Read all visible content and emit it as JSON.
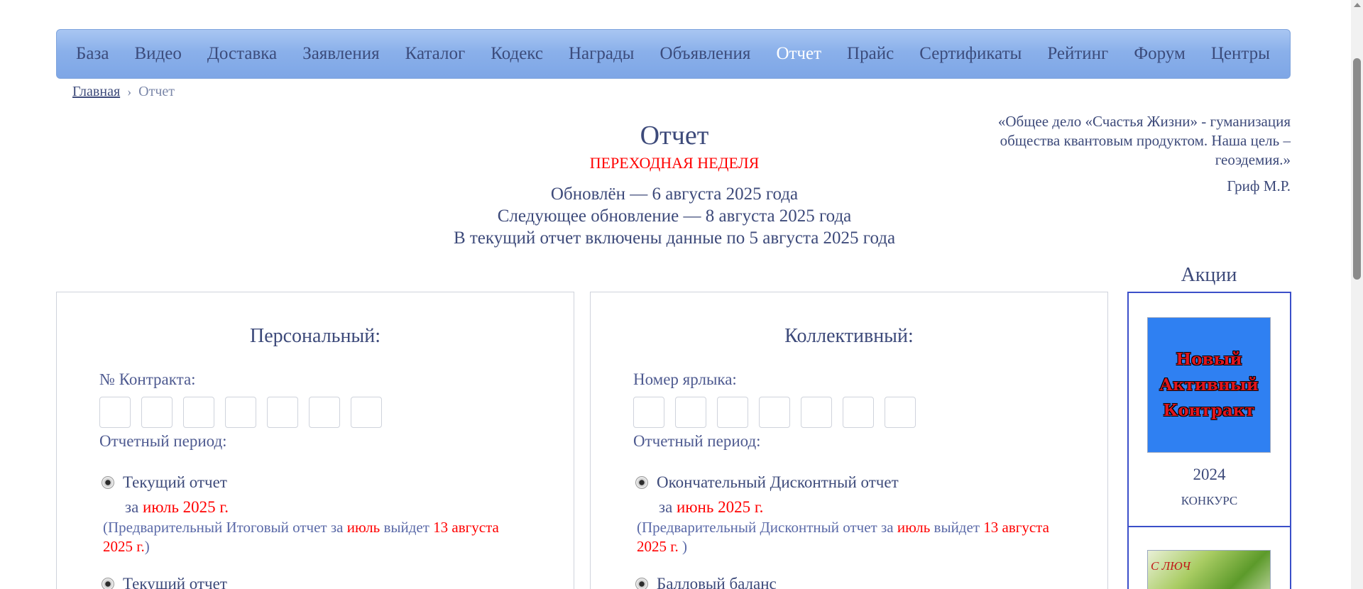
{
  "nav": {
    "items": [
      {
        "label": "База"
      },
      {
        "label": "Видео"
      },
      {
        "label": "Доставка"
      },
      {
        "label": "Заявления"
      },
      {
        "label": "Каталог"
      },
      {
        "label": "Кодекс"
      },
      {
        "label": "Награды"
      },
      {
        "label": "Объявления"
      },
      {
        "label": "Отчет",
        "active": true
      },
      {
        "label": "Прайс"
      },
      {
        "label": "Сертификаты"
      },
      {
        "label": "Рейтинг"
      },
      {
        "label": "Форум"
      },
      {
        "label": "Центры"
      }
    ]
  },
  "breadcrumb": {
    "home": "Главная",
    "separator": "›",
    "current": "Отчет"
  },
  "header": {
    "title": "Отчет",
    "subtitle": "ПЕРЕХОДНАЯ НЕДЕЛЯ",
    "updated": "Обновлён — 6 августа 2025 года",
    "next_update": "Следующее обновление — 8 августа 2025 года",
    "included": "В текущий отчет включены данные по 5 августа 2025 года"
  },
  "quote": {
    "text": "«Общее дело «Счастья Жизни» - гуманизация общества квантовым продуктом. Наша цель – геоэдемия.»",
    "author": "Гриф М.Р."
  },
  "personal": {
    "title": "Персональный:",
    "contract_label": "№ Контракта:",
    "period_label": "Отчетный период:",
    "option1_label": "Текущий отчет",
    "option1_period_prefix": "за ",
    "option1_period_value": "июль 2025 г.",
    "note_prefix": "(Предварительный Итоговый отчет за ",
    "note_month": "июль",
    "note_middle": " выйдет ",
    "note_date": "13 августа 2025 г.",
    "note_suffix": ")",
    "option2_label": "Текущий отчет"
  },
  "collective": {
    "title": "Коллективный:",
    "label_label": "Номер ярлыка:",
    "period_label": "Отчетный период:",
    "option1_label": "Окончательный Дисконтный отчет",
    "option1_period_prefix": "за ",
    "option1_period_value": "июнь 2025 г.",
    "note_prefix": "(Предварительный Дисконтный отчет за ",
    "note_month": "июль",
    "note_middle": " выйдет ",
    "note_date": "13 августа 2025 г.",
    "note_suffix": " )",
    "option2_label": "Балловый баланс"
  },
  "promos": {
    "title": "Акции",
    "card1": {
      "image_lines": [
        "Новый",
        "Активный",
        "Контракт"
      ],
      "year": "2024",
      "label": "КОНКУРС"
    },
    "card2": {
      "image_text": "С ЛЮЧ"
    }
  },
  "colors": {
    "nav_gradient_top": "#a9c6f2",
    "nav_gradient_bottom": "#7ea6e6",
    "text": "#3d4a7a",
    "accent_red": "#ff0000",
    "promo_border": "#3b4fc9",
    "promo_bg": "#2f80f2"
  }
}
